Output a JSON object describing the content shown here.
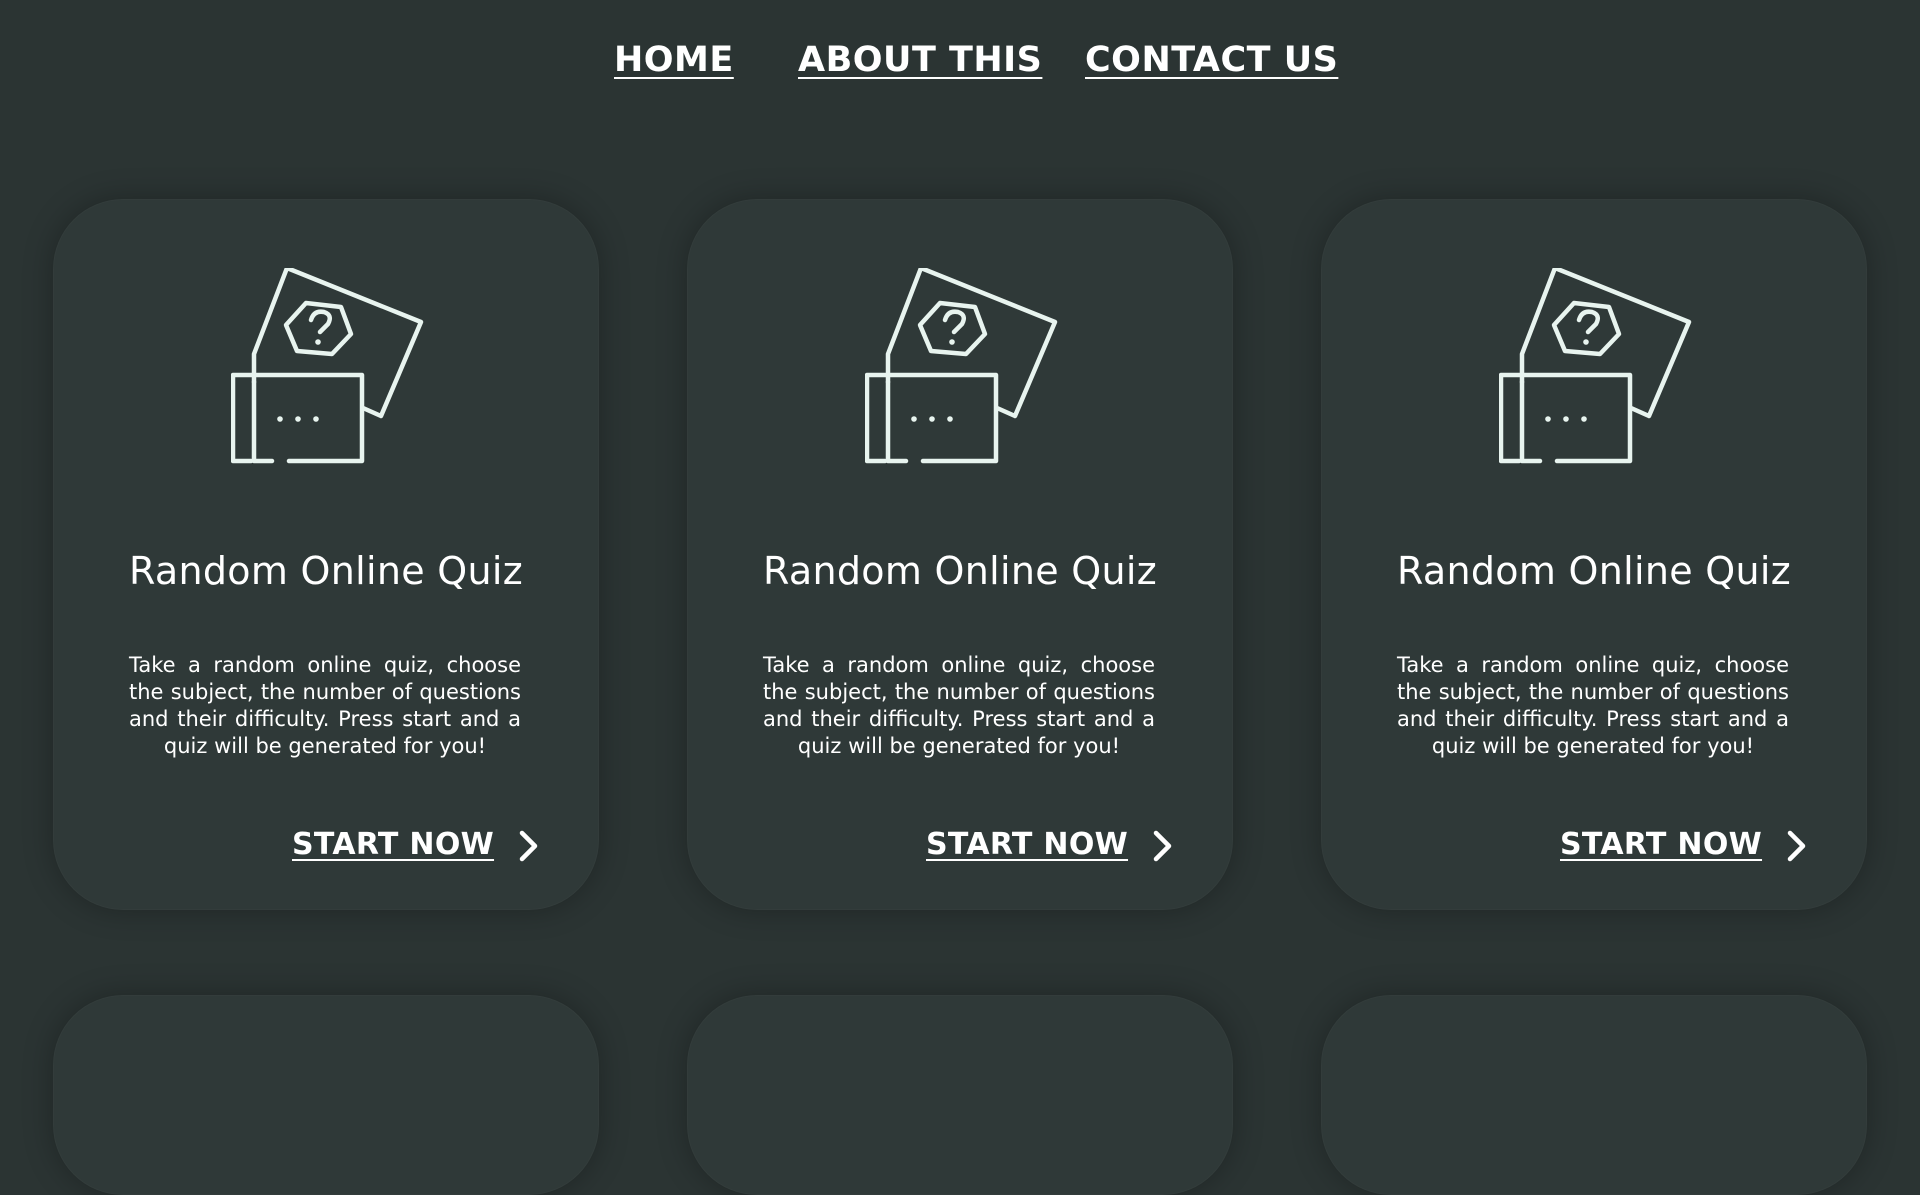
{
  "nav": {
    "home": "HOME",
    "about": "ABOUT THIS",
    "contact": "CONTACT US"
  },
  "cards": [
    {
      "icon": "quiz-cards-icon",
      "title": "Random Online Quiz",
      "description": "Take a random online quiz, choose the subject,  the number of questions and their difficulty. Press start and a quiz will be generated for you!",
      "cta": "START NOW",
      "cta_icon": "chevron-right-icon"
    },
    {
      "icon": "quiz-cards-icon",
      "title": "Random Online Quiz",
      "description": "Take a random online quiz, choose the subject,  the number of questions and their difficulty. Press start and a quiz will be generated for you!",
      "cta": "START NOW",
      "cta_icon": "chevron-right-icon"
    },
    {
      "icon": "quiz-cards-icon",
      "title": "Random Online Quiz",
      "description": "Take a random online quiz, choose the subject,  the number of questions and their difficulty. Press start and a quiz will be generated for you!",
      "cta": "START NOW",
      "cta_icon": "chevron-right-icon"
    }
  ],
  "colors": {
    "background": "#2b3433",
    "card": "#2f3938",
    "icon_stroke": "#e8f4ef",
    "text": "#ffffff"
  }
}
